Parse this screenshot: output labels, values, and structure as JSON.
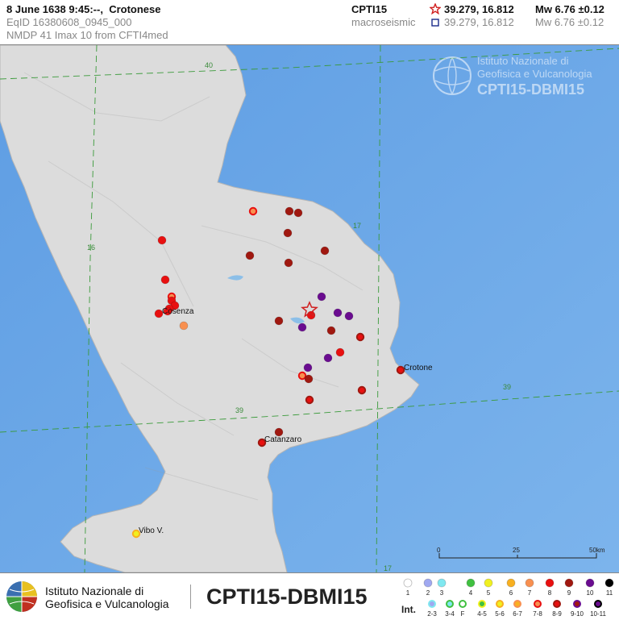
{
  "header": {
    "date_time": "8 June 1638  9:45:--,",
    "location": "Crotonese",
    "eqid": "EqID 16380608_0945_000",
    "nmdp_line": "NMDP  41   Imax 10   from CFTI4med",
    "catalog": "CPTI15",
    "catalog_sub": "macroseismic",
    "epicenter_coords": "39.279, 16.812",
    "epicenter_mw": "Mw 6.76 ±0.12",
    "macro_coords": "39.279, 16.812",
    "macro_mw": "Mw 6.76 ±0.12"
  },
  "watermark": {
    "line1": "Istituto Nazionale di",
    "line2": "Geofisica e Vulcanologia",
    "line3": "CPTI15-DBMI15"
  },
  "map": {
    "colors": {
      "sea": "#6fa8e6",
      "land": "#dcdcdc",
      "grid": "#3a9a3a"
    },
    "grid_labels": [
      {
        "text": "40"
      },
      {
        "text": "16"
      },
      {
        "text": "17"
      },
      {
        "text": "39"
      },
      {
        "text": "39"
      },
      {
        "text": "17"
      }
    ],
    "places": [
      {
        "name": "Cosenza"
      },
      {
        "name": "Crotone"
      },
      {
        "name": "Catanzaro"
      },
      {
        "name": "Vibo V."
      }
    ],
    "scale": {
      "labels": [
        "0",
        "25",
        "50km"
      ]
    }
  },
  "intensity_colors": {
    "1": "#ffffff",
    "2": "#a0a8f0",
    "3": "#80e8f0",
    "4": "#40c040",
    "4-5": "#b0e040",
    "5": "#f0f020",
    "5-6": "#f0d020",
    "6": "#f8b020",
    "6-7": "#f89040",
    "7": "#f89050",
    "7-8": "#f06030",
    "8": "#e81010",
    "8-9": "#c01010",
    "9": "#a01810",
    "9-10": "#8a1060",
    "10": "#6a0c90",
    "10-11": "#30087a",
    "11": "#000000"
  },
  "footer": {
    "inst_line1": "Istituto Nazionale di",
    "inst_line2": "Geofisica e Vulcanologia",
    "title": "CPTI15-DBMI15",
    "int_label": "Int.",
    "legend_top": [
      "1",
      "2",
      "3",
      "4",
      "5",
      "6",
      "7",
      "8",
      "9",
      "10",
      "11"
    ],
    "legend_bottom": [
      "2-3",
      "3-4",
      "F",
      "4-5",
      "5-6",
      "6-7",
      "7-8",
      "8-9",
      "9-10",
      "10-11"
    ]
  }
}
